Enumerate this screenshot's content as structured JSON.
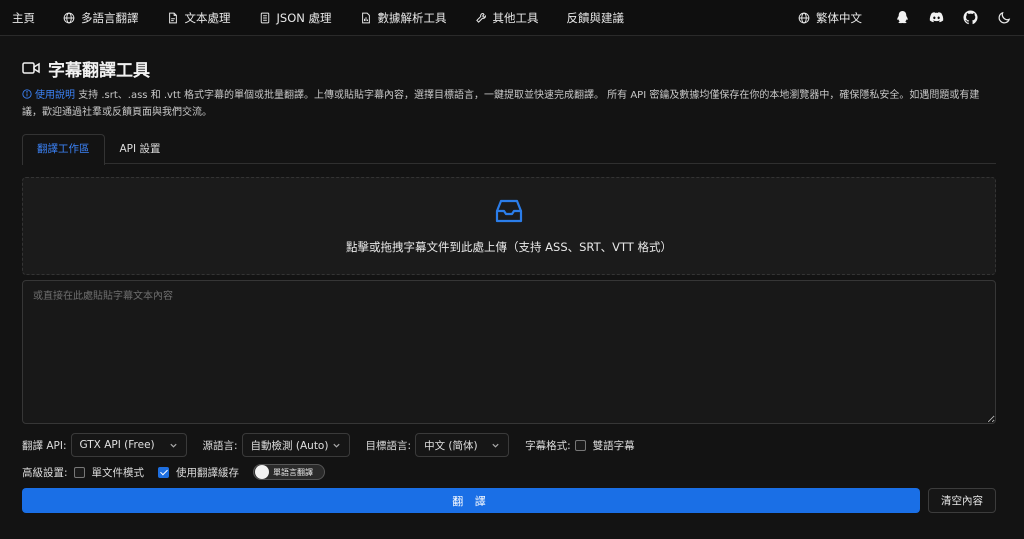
{
  "nav": {
    "items": [
      {
        "label": "主頁",
        "icon": "none"
      },
      {
        "label": "多語言翻譯",
        "icon": "globe-icon"
      },
      {
        "label": "文本處理",
        "icon": "document-icon"
      },
      {
        "label": "JSON 處理",
        "icon": "list-icon"
      },
      {
        "label": "數據解析工具",
        "icon": "chart-doc-icon"
      },
      {
        "label": "其他工具",
        "icon": "wrench-icon"
      },
      {
        "label": "反饋與建議",
        "icon": "none"
      }
    ],
    "language": "繁体中文"
  },
  "page": {
    "title": "字幕翻譯工具",
    "help_link": "使用說明",
    "description": "支持 .srt、.ass 和 .vtt 格式字幕的單個或批量翻譯。上傳或貼貼字幕內容，選擇目標語言，一鍵提取並快速完成翻譯。 所有 API 密鑰及數據均僅保存在你的本地瀏覽器中，確保隱私安全。如遇問題或有建議，歡迎通過社羣或反饋頁面與我們交流。"
  },
  "tabs": [
    {
      "label": "翻譯工作區",
      "active": true
    },
    {
      "label": "API 設置",
      "active": false
    }
  ],
  "dropzone": {
    "text": "點擊或拖拽字幕文件到此處上傳（支持 ASS、SRT、VTT 格式）"
  },
  "textarea": {
    "placeholder": "或直接在此處貼貼字幕文本內容",
    "value": ""
  },
  "controls": {
    "api_label": "翻譯 API:",
    "api_value": "GTX API (Free)",
    "source_label": "源語言:",
    "source_value": "自動檢測 (Auto)",
    "target_label": "目標語言:",
    "target_value": "中文 (简体)",
    "format_label": "字幕格式:",
    "bilingual_label": "雙語字幕",
    "bilingual_checked": false
  },
  "advanced": {
    "label": "高級設置:",
    "single_file_label": "單文件模式",
    "single_file_checked": false,
    "cache_label": "使用翻譯緩存",
    "cache_checked": true,
    "toggle_label": "單語言翻譯",
    "toggle_on": false
  },
  "actions": {
    "translate": "翻 譯",
    "clear": "清空內容"
  },
  "colors": {
    "accent": "#1a6fe6",
    "link": "#3b82f6",
    "background": "#131313"
  }
}
